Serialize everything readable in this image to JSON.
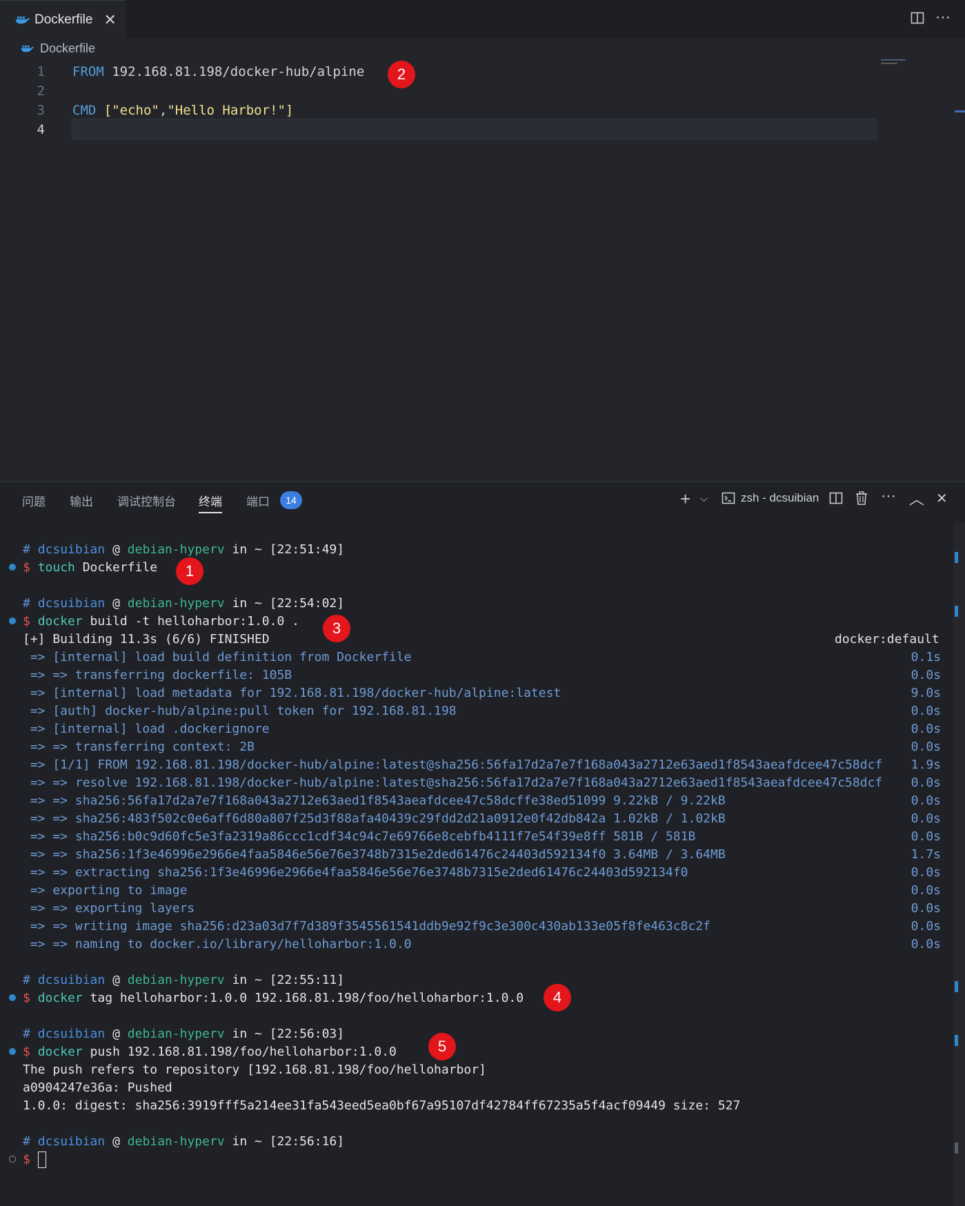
{
  "editor": {
    "tab_title": "Dockerfile",
    "breadcrumb": "Dockerfile",
    "line_numbers": [
      "1",
      "2",
      "3",
      "4"
    ],
    "line1_kw": "FROM",
    "line1_rest": " 192.168.81.198/docker-hub/alpine",
    "line3_kw": "CMD",
    "line3_open": " [",
    "line3_s1": "\"echo\"",
    "line3_comma": ",",
    "line3_s2": "\"Hello Harbor!\"",
    "line3_close": "]"
  },
  "panel": {
    "tabs": [
      "问题",
      "输出",
      "调试控制台",
      "终端",
      "端口"
    ],
    "ports_badge": "14",
    "shell_label": "zsh - dcsuibian"
  },
  "prompts": [
    {
      "hash": "#",
      "user": "dcsuibian",
      "at": "@",
      "host": "debian-hyperv",
      "in": "in",
      "dir": "~",
      "time": "[22:51:49]"
    },
    {
      "hash": "#",
      "user": "dcsuibian",
      "at": "@",
      "host": "debian-hyperv",
      "in": "in",
      "dir": "~",
      "time": "[22:54:02]"
    },
    {
      "hash": "#",
      "user": "dcsuibian",
      "at": "@",
      "host": "debian-hyperv",
      "in": "in",
      "dir": "~",
      "time": "[22:55:11]"
    },
    {
      "hash": "#",
      "user": "dcsuibian",
      "at": "@",
      "host": "debian-hyperv",
      "in": "in",
      "dir": "~",
      "time": "[22:56:03]"
    },
    {
      "hash": "#",
      "user": "dcsuibian",
      "at": "@",
      "host": "debian-hyperv",
      "in": "in",
      "dir": "~",
      "time": "[22:56:16]"
    }
  ],
  "commands": [
    {
      "dollar": "$",
      "bin": "touch",
      "args": " Dockerfile"
    },
    {
      "dollar": "$",
      "bin": "docker",
      "args": " build -t helloharbor:1.0.0 ."
    },
    {
      "dollar": "$",
      "bin": "docker",
      "args": " tag helloharbor:1.0.0 192.168.81.198/foo/helloharbor:1.0.0"
    },
    {
      "dollar": "$",
      "bin": "docker",
      "args": " push 192.168.81.198/foo/helloharbor:1.0.0"
    },
    {
      "dollar": "$"
    }
  ],
  "build": {
    "header": "[+] Building 11.3s (6/6) FINISHED",
    "builder": "docker:default",
    "steps": [
      {
        "text": " => [internal] load build definition from Dockerfile",
        "time": "0.1s"
      },
      {
        "text": " => => transferring dockerfile: 105B",
        "time": "0.0s"
      },
      {
        "text": " => [internal] load metadata for 192.168.81.198/docker-hub/alpine:latest",
        "time": "9.0s"
      },
      {
        "text": " => [auth] docker-hub/alpine:pull token for 192.168.81.198",
        "time": "0.0s"
      },
      {
        "text": " => [internal] load .dockerignore",
        "time": "0.0s"
      },
      {
        "text": " => => transferring context: 2B",
        "time": "0.0s"
      },
      {
        "text": " => [1/1] FROM 192.168.81.198/docker-hub/alpine:latest@sha256:56fa17d2a7e7f168a043a2712e63aed1f8543aeafdcee47c58dcf",
        "time": "1.9s"
      },
      {
        "text": " => => resolve 192.168.81.198/docker-hub/alpine:latest@sha256:56fa17d2a7e7f168a043a2712e63aed1f8543aeafdcee47c58dcf",
        "time": "0.0s"
      },
      {
        "text": " => => sha256:56fa17d2a7e7f168a043a2712e63aed1f8543aeafdcee47c58dcffe38ed51099 9.22kB / 9.22kB",
        "time": "0.0s"
      },
      {
        "text": " => => sha256:483f502c0e6aff6d80a807f25d3f88afa40439c29fdd2d21a0912e0f42db842a 1.02kB / 1.02kB",
        "time": "0.0s"
      },
      {
        "text": " => => sha256:b0c9d60fc5e3fa2319a86ccc1cdf34c94c7e69766e8cebfb4111f7e54f39e8ff 581B / 581B",
        "time": "0.0s"
      },
      {
        "text": " => => sha256:1f3e46996e2966e4faa5846e56e76e3748b7315e2ded61476c24403d592134f0 3.64MB / 3.64MB",
        "time": "1.7s"
      },
      {
        "text": " => => extracting sha256:1f3e46996e2966e4faa5846e56e76e3748b7315e2ded61476c24403d592134f0",
        "time": "0.0s"
      },
      {
        "text": " => exporting to image",
        "time": "0.0s"
      },
      {
        "text": " => => exporting layers",
        "time": "0.0s"
      },
      {
        "text": " => => writing image sha256:d23a03d7f7d389f3545561541ddb9e92f9c3e300c430ab133e05f8fe463c8c2f",
        "time": "0.0s"
      },
      {
        "text": " => => naming to docker.io/library/helloharbor:1.0.0",
        "time": "0.0s"
      }
    ]
  },
  "push_output": [
    "The push refers to repository [192.168.81.198/foo/helloharbor]",
    "a0904247e36a: Pushed",
    "1.0.0: digest: sha256:3919fff5a214ee31fa543eed5ea0bf67a95107df42784ff67235a5f4acf09449 size: 527"
  ],
  "annotations": [
    "1",
    "2",
    "3",
    "4",
    "5"
  ],
  "colors": {
    "annotation": "#e3161b",
    "accent": "#3e7ee0",
    "prompt_dollar": "#ef5151",
    "command": "#4ec7b7"
  }
}
